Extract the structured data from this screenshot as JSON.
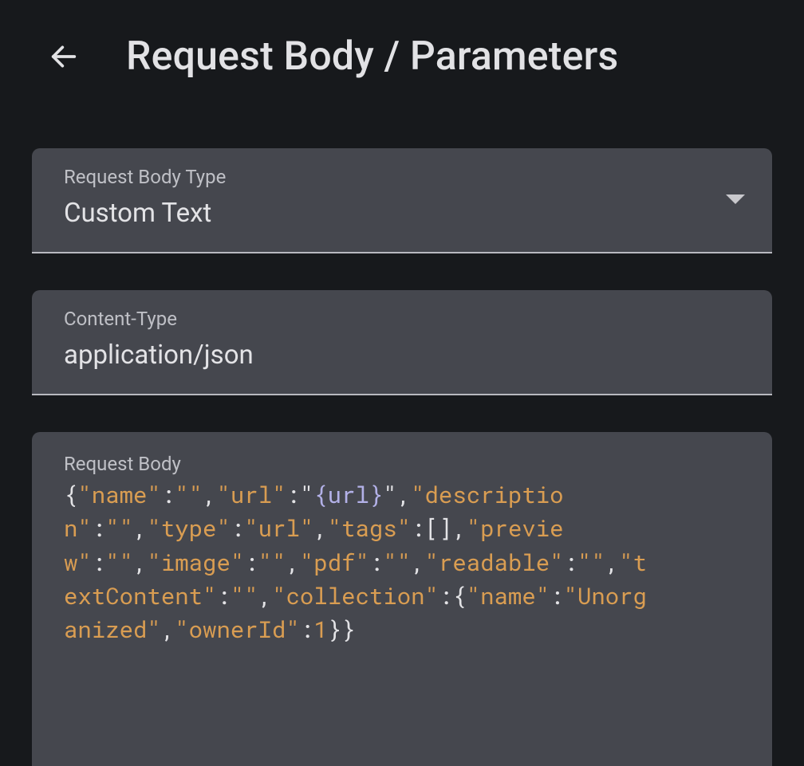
{
  "header": {
    "title": "Request Body / Parameters"
  },
  "fields": {
    "bodyType": {
      "label": "Request Body Type",
      "value": "Custom Text"
    },
    "contentType": {
      "label": "Content-Type",
      "value": "application/json"
    },
    "requestBody": {
      "label": "Request Body",
      "raw": "{\"name\":\"\",\"url\":\"{url}\",\"description\":\"\",\"type\":\"url\",\"tags\":[],\"preview\":\"\",\"image\":\"\",\"pdf\":\"\",\"readable\":\"\",\"textContent\":\"\",\"collection\":{\"name\":\"Unorganized\",\"ownerId\":1}}",
      "tokens": [
        {
          "t": "p",
          "v": "{"
        },
        {
          "t": "key",
          "v": "\"name\""
        },
        {
          "t": "p",
          "v": ":"
        },
        {
          "t": "str",
          "v": "\"\""
        },
        {
          "t": "p",
          "v": ","
        },
        {
          "t": "key",
          "v": "\"url\""
        },
        {
          "t": "p",
          "v": ":"
        },
        {
          "t": "p",
          "v": "\""
        },
        {
          "t": "var",
          "v": "{url}"
        },
        {
          "t": "p",
          "v": "\""
        },
        {
          "t": "p",
          "v": ","
        },
        {
          "t": "key",
          "v": "\"description\""
        },
        {
          "t": "p",
          "v": ":"
        },
        {
          "t": "str",
          "v": "\"\""
        },
        {
          "t": "p",
          "v": ","
        },
        {
          "t": "key",
          "v": "\"type\""
        },
        {
          "t": "p",
          "v": ":"
        },
        {
          "t": "str",
          "v": "\"url\""
        },
        {
          "t": "p",
          "v": ","
        },
        {
          "t": "key",
          "v": "\"tags\""
        },
        {
          "t": "p",
          "v": ":"
        },
        {
          "t": "p",
          "v": "[]"
        },
        {
          "t": "p",
          "v": ","
        },
        {
          "t": "key",
          "v": "\"preview\""
        },
        {
          "t": "p",
          "v": ":"
        },
        {
          "t": "str",
          "v": "\"\""
        },
        {
          "t": "p",
          "v": ","
        },
        {
          "t": "key",
          "v": "\"image\""
        },
        {
          "t": "p",
          "v": ":"
        },
        {
          "t": "str",
          "v": "\"\""
        },
        {
          "t": "p",
          "v": ","
        },
        {
          "t": "key",
          "v": "\"pdf\""
        },
        {
          "t": "p",
          "v": ":"
        },
        {
          "t": "str",
          "v": "\"\""
        },
        {
          "t": "p",
          "v": ","
        },
        {
          "t": "key",
          "v": "\"readable\""
        },
        {
          "t": "p",
          "v": ":"
        },
        {
          "t": "str",
          "v": "\"\""
        },
        {
          "t": "p",
          "v": ","
        },
        {
          "t": "key",
          "v": "\"textContent\""
        },
        {
          "t": "p",
          "v": ":"
        },
        {
          "t": "str",
          "v": "\"\""
        },
        {
          "t": "p",
          "v": ","
        },
        {
          "t": "key",
          "v": "\"collection\""
        },
        {
          "t": "p",
          "v": ":"
        },
        {
          "t": "p",
          "v": "{"
        },
        {
          "t": "key",
          "v": "\"name\""
        },
        {
          "t": "p",
          "v": ":"
        },
        {
          "t": "str",
          "v": "\"Unorganized\""
        },
        {
          "t": "p",
          "v": ","
        },
        {
          "t": "key",
          "v": "\"ownerId\""
        },
        {
          "t": "p",
          "v": ":"
        },
        {
          "t": "num",
          "v": "1"
        },
        {
          "t": "p",
          "v": "}"
        },
        {
          "t": "p",
          "v": "}"
        }
      ]
    }
  }
}
